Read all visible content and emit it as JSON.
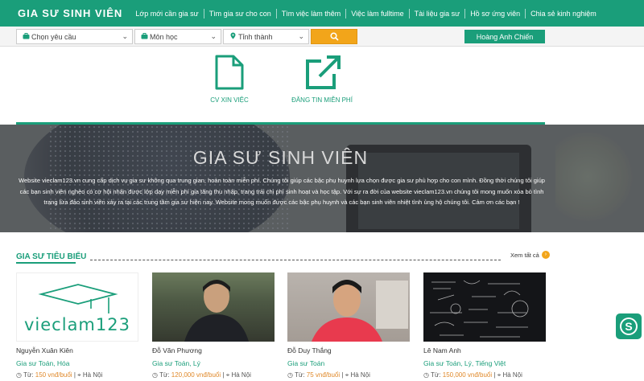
{
  "nav": {
    "logo": "GIA SƯ SINH VIÊN",
    "links": [
      "Lớp mới cần gia sư",
      "Tìm gia sư cho con",
      "Tìm việc làm thêm",
      "Việc làm fulltime",
      "Tài liệu gia sư",
      "Hồ sơ ứng viên",
      "Chia sẻ kinh nghiệm"
    ]
  },
  "search": {
    "requirement_placeholder": "Chọn yêu cầu",
    "subject_placeholder": "Môn học",
    "city_placeholder": "Tỉnh thành",
    "user_name": "Hoàng Anh Chiến"
  },
  "actions": {
    "cv_label": "CV XIN VIỆC",
    "post_label": "ĐĂNG TIN MIỄN PHÍ"
  },
  "hero": {
    "title": "GIA SƯ SINH VIÊN",
    "description": "Website vieclam123.vn cung cấp dịch vụ gia sư không qua trung gian, hoàn toàn miễn phí. Chúng tôi giúp các bậc phụ huynh lựa chọn được gia sư phù hợp cho con mình. Đồng thời chúng tôi giúp các bạn sinh viên nghèo có cơ hội nhận được lớp dạy miễn phí gia tăng thu nhập, trang trải chi phí sinh hoạt và học tập. Với sự ra đời của website vieclam123.vn chúng tôi mong muốn xóa bỏ tình trạng lừa đảo sinh viên xảy ra tại các trung tâm gia sư hiện nay. Website mong muốn được các bậc phụ huynh và các bạn sinh viên nhiệt tình ủng hộ chúng tôi. Cảm ơn các bạn !"
  },
  "featured": {
    "title": "GIA SƯ TIÊU BIỂU",
    "see_all": "Xem tất cả",
    "logo_text": "vieclam123",
    "fee_prefix": "Từ:",
    "tutors": [
      {
        "name": "Nguyễn Xuân Kiên",
        "subjects": "Gia sư Toán, Hóa",
        "fee": "150 vnđ/buổi",
        "city": "Hà Nội"
      },
      {
        "name": "Đỗ Văn Phương",
        "subjects": "Gia sư Toán, Lý",
        "fee": "120,000 vnđ/buổi",
        "city": "Hà Nội"
      },
      {
        "name": "Đỗ Duy Thắng",
        "subjects": "Gia sư Toán",
        "fee": "75 vnđ/buổi",
        "city": "Hà Nội"
      },
      {
        "name": "Lê Nam Anh",
        "subjects": "Gia sư Toán, Lý, Tiếng Việt",
        "fee": "150,000 vnđ/buổi",
        "city": "Hà Nội"
      }
    ]
  },
  "colors": {
    "primary": "#1a9e7a",
    "accent": "#f2a51a"
  }
}
